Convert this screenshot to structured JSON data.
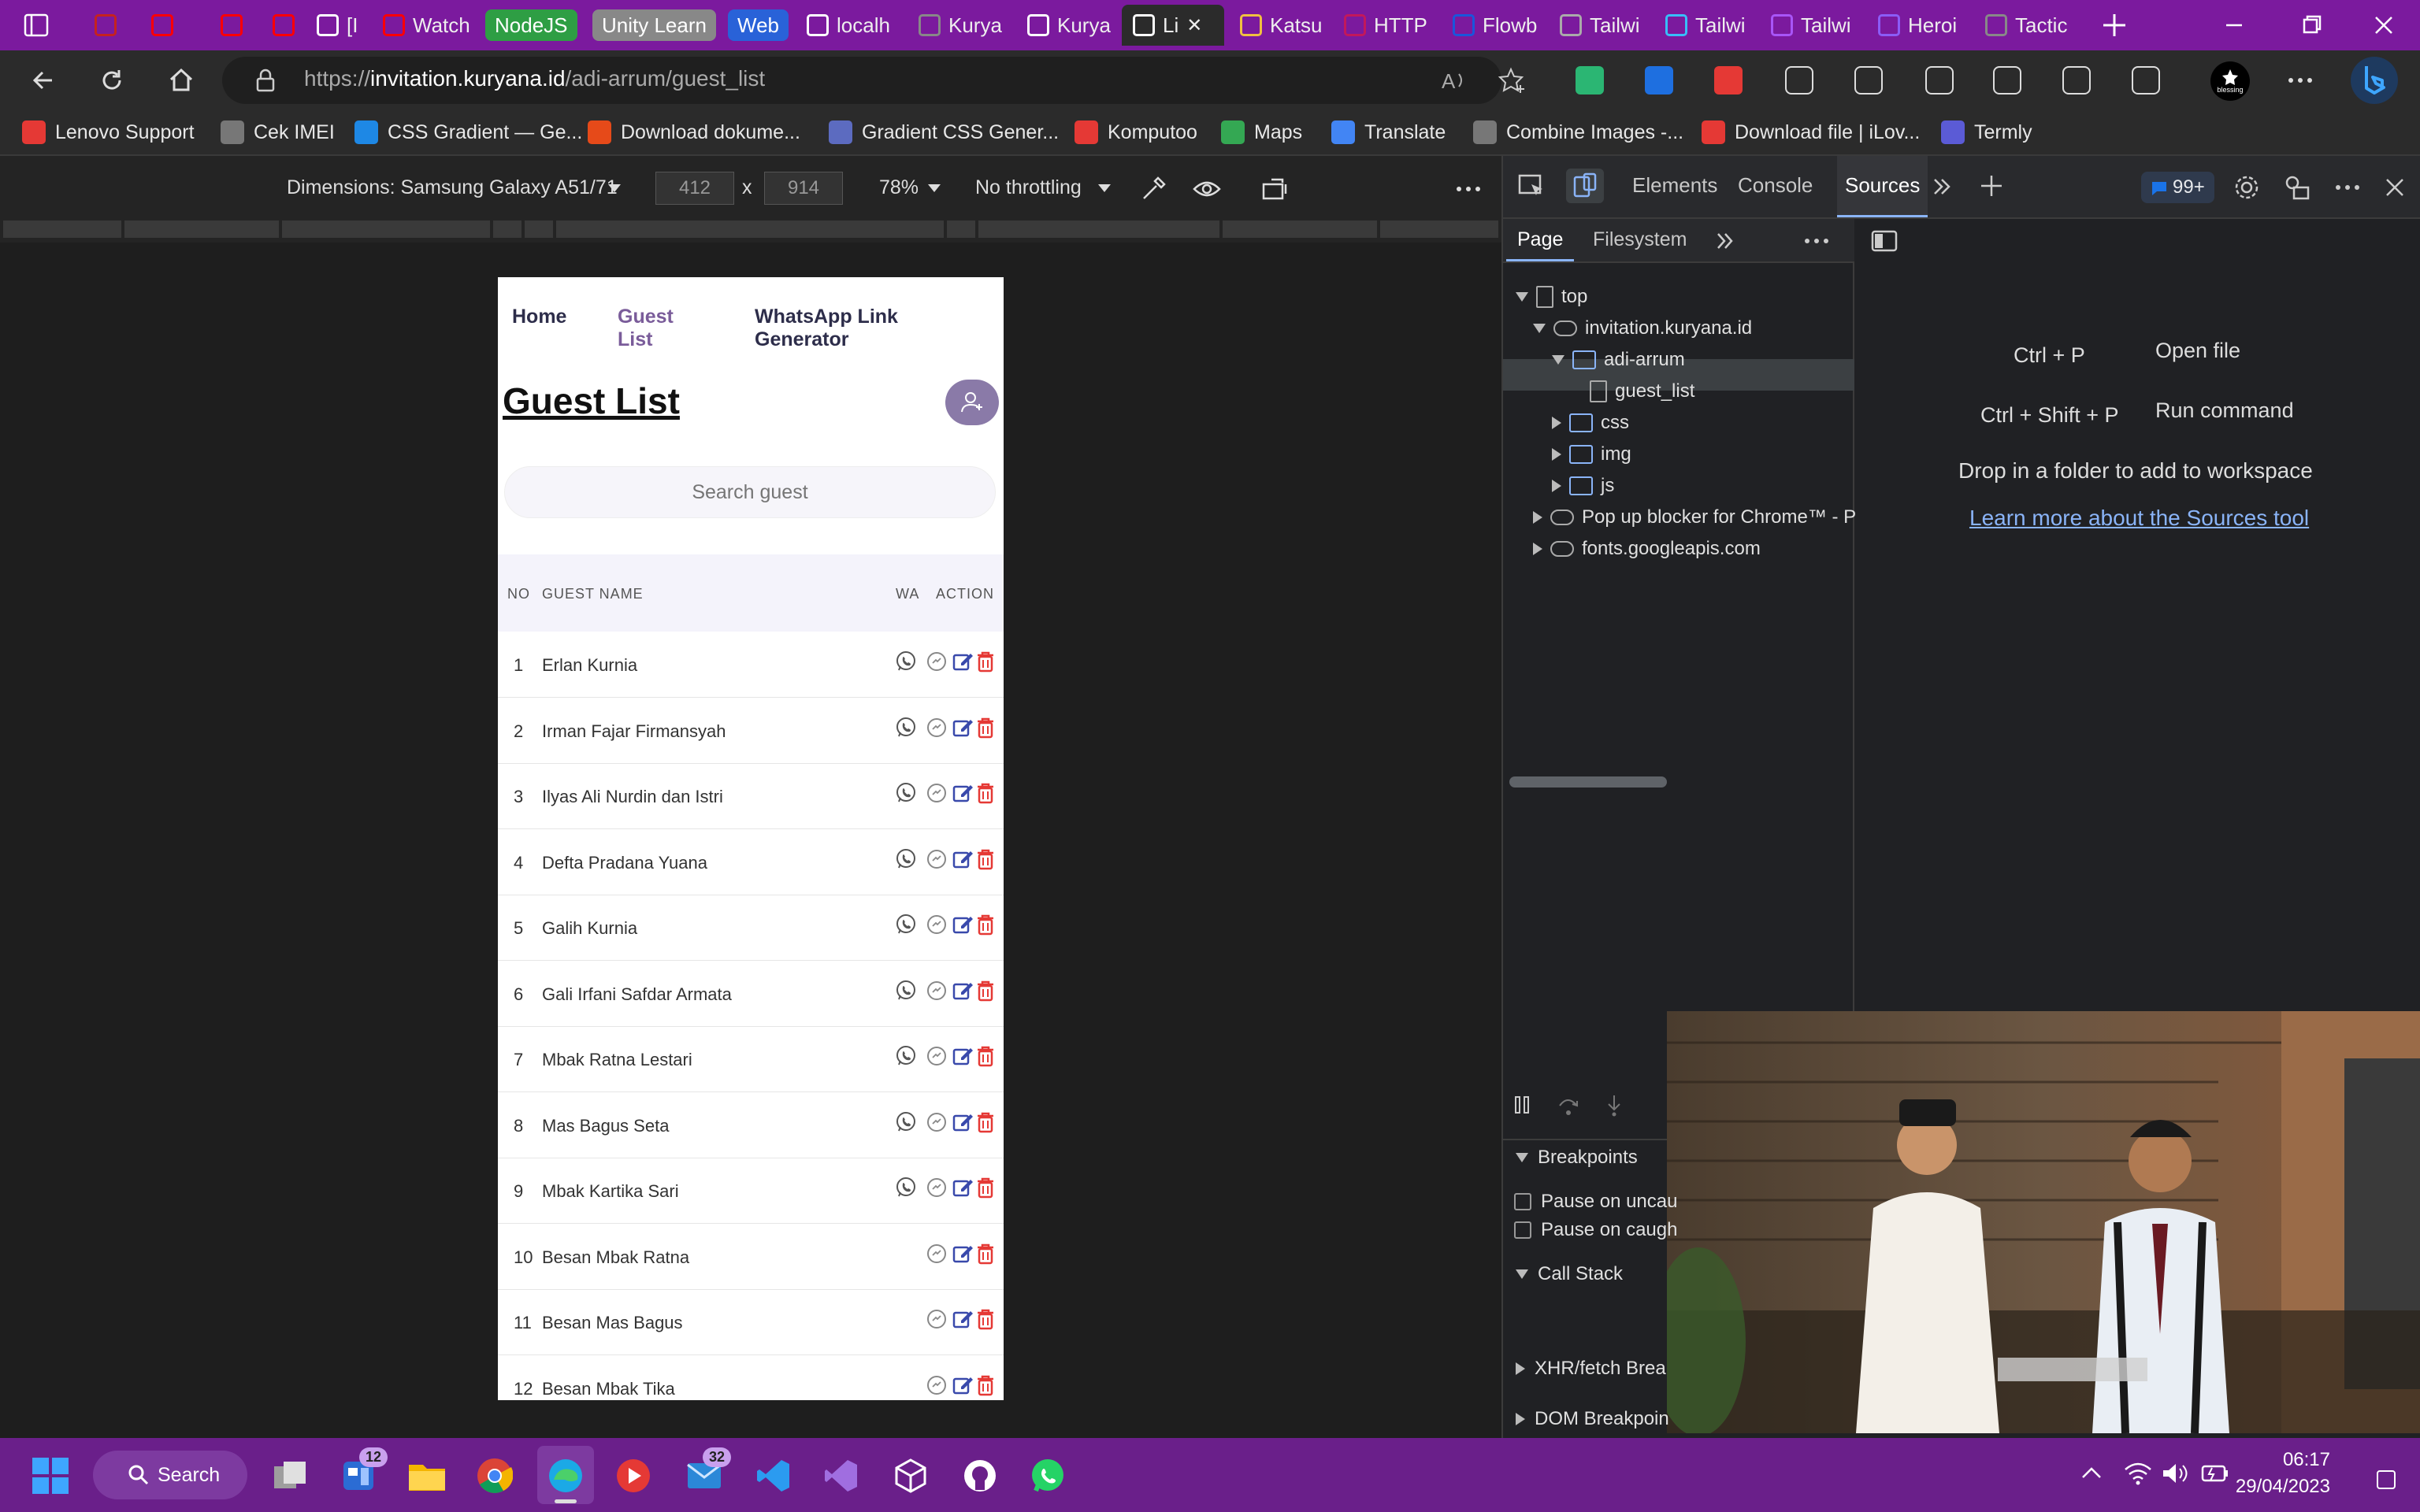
{
  "browser": {
    "tabs": [
      {
        "label": "",
        "icon": "gmail-icon",
        "color": "#c5221f"
      },
      {
        "label": "",
        "icon": "youtube-icon",
        "color": "#ff0000"
      },
      {
        "label": "",
        "icon": "youtube-icon",
        "color": "#ff0000"
      },
      {
        "label": "",
        "icon": "youtube-icon",
        "color": "#ff0000"
      },
      {
        "label": "[I",
        "icon": "instagram-icon",
        "color": "#ffffff"
      },
      {
        "label": "Watch",
        "icon": "youtube-icon",
        "color": "#ff0000"
      },
      {
        "label": "localh",
        "icon": "react-icon",
        "color": "#ffffff"
      },
      {
        "label": "Kurya",
        "icon": "page-icon",
        "color": "#888888"
      },
      {
        "label": "Kurya",
        "icon": "github-icon",
        "color": "#ffffff"
      },
      {
        "label": "Li",
        "icon": "page-icon",
        "color": "#ffffff"
      },
      {
        "label": "Katsu",
        "icon": "katsu-icon",
        "color": "#f0c040"
      },
      {
        "label": "HTTP",
        "icon": "http-icon",
        "color": "#c2185b"
      },
      {
        "label": "Flowb",
        "icon": "flowbite-icon",
        "color": "#1a56db"
      },
      {
        "label": "Tailwi",
        "icon": "page-icon",
        "color": "#aaaaaa"
      },
      {
        "label": "Tailwi",
        "icon": "tailwind-icon",
        "color": "#38bdf8"
      },
      {
        "label": "Tailwi",
        "icon": "tailwind-icon",
        "color": "#a855f7"
      },
      {
        "label": "Heroi",
        "icon": "heroicons-icon",
        "color": "#8b5cf6"
      },
      {
        "label": "Tactic",
        "icon": "tactic-icon",
        "color": "#888888"
      }
    ],
    "tab_groups": [
      "NodeJS",
      "Unity Learn",
      "Web"
    ],
    "url_prefix": "https://",
    "url_host": "invitation.kuryana.id",
    "url_path": "/adi-arrum/guest_list",
    "profile_label": "blessing",
    "bookmarks": [
      "Lenovo Support",
      "Cek IMEI",
      "CSS Gradient — Ge...",
      "Download dokume...",
      "Gradient CSS Gener...",
      "Komputoo",
      "Maps",
      "Translate",
      "Combine Images -...",
      "Download file | iLov...",
      "Termly"
    ]
  },
  "device_toolbar": {
    "dimensions": "Dimensions: Samsung Galaxy A51/71",
    "width": "412",
    "height": "914",
    "times": "x",
    "zoom": "78%",
    "throttle": "No throttling"
  },
  "site": {
    "nav": [
      "Home",
      "Guest",
      "List",
      "WhatsApp Link",
      "Generator"
    ],
    "title": "Guest List",
    "search_placeholder": "Search guest",
    "columns": [
      "NO",
      "GUEST NAME",
      "WA",
      "ACTION"
    ],
    "guests": [
      {
        "no": "1",
        "name": "Erlan Kurnia",
        "wa": true
      },
      {
        "no": "2",
        "name": "Irman Fajar Firmansyah",
        "wa": true
      },
      {
        "no": "3",
        "name": "Ilyas Ali Nurdin dan Istri",
        "wa": true
      },
      {
        "no": "4",
        "name": "Defta Pradana Yuana",
        "wa": true
      },
      {
        "no": "5",
        "name": "Galih Kurnia",
        "wa": true
      },
      {
        "no": "6",
        "name": "Gali Irfani Safdar Armata",
        "wa": true
      },
      {
        "no": "7",
        "name": "Mbak Ratna Lestari",
        "wa": true
      },
      {
        "no": "8",
        "name": "Mas Bagus Seta",
        "wa": true
      },
      {
        "no": "9",
        "name": "Mbak Kartika Sari",
        "wa": true
      },
      {
        "no": "10",
        "name": "Besan Mbak Ratna",
        "wa": false
      },
      {
        "no": "11",
        "name": "Besan Mas Bagus",
        "wa": false
      },
      {
        "no": "12",
        "name": "Besan Mbak Tika",
        "wa": false
      }
    ]
  },
  "devtools": {
    "tabs": [
      "Elements",
      "Console",
      "Sources"
    ],
    "issues": "99+",
    "subtabs": [
      "Page",
      "Filesystem"
    ],
    "tree": [
      "top",
      "invitation.kuryana.id",
      "adi-arrum",
      "guest_list",
      "css",
      "img",
      "js",
      "Pop up blocker for Chrome™ - P",
      "fonts.googleapis.com"
    ],
    "shortcuts": [
      {
        "keys": "Ctrl + P",
        "action": "Open file"
      },
      {
        "keys": "Ctrl + Shift + P",
        "action": "Run command"
      }
    ],
    "drop_text": "Drop in a folder to add to workspace",
    "learn_link": "Learn more about the Sources tool",
    "debugger": [
      "Breakpoints",
      "Pause on uncau",
      "Pause on caugh",
      "Call Stack",
      "XHR/fetch Brea",
      "DOM Breakpoin"
    ]
  },
  "taskbar": {
    "search": "Search",
    "mail_badge": "32",
    "widgets_badge": "12",
    "time": "06:17",
    "date": "29/04/2023"
  },
  "colors": {
    "tabbar": "#7b1a9e",
    "taskbar": "#6a1f8a",
    "accent_purple": "#8a7aa8",
    "delete_red": "#e53935",
    "edit_blue": "#3949ab"
  }
}
